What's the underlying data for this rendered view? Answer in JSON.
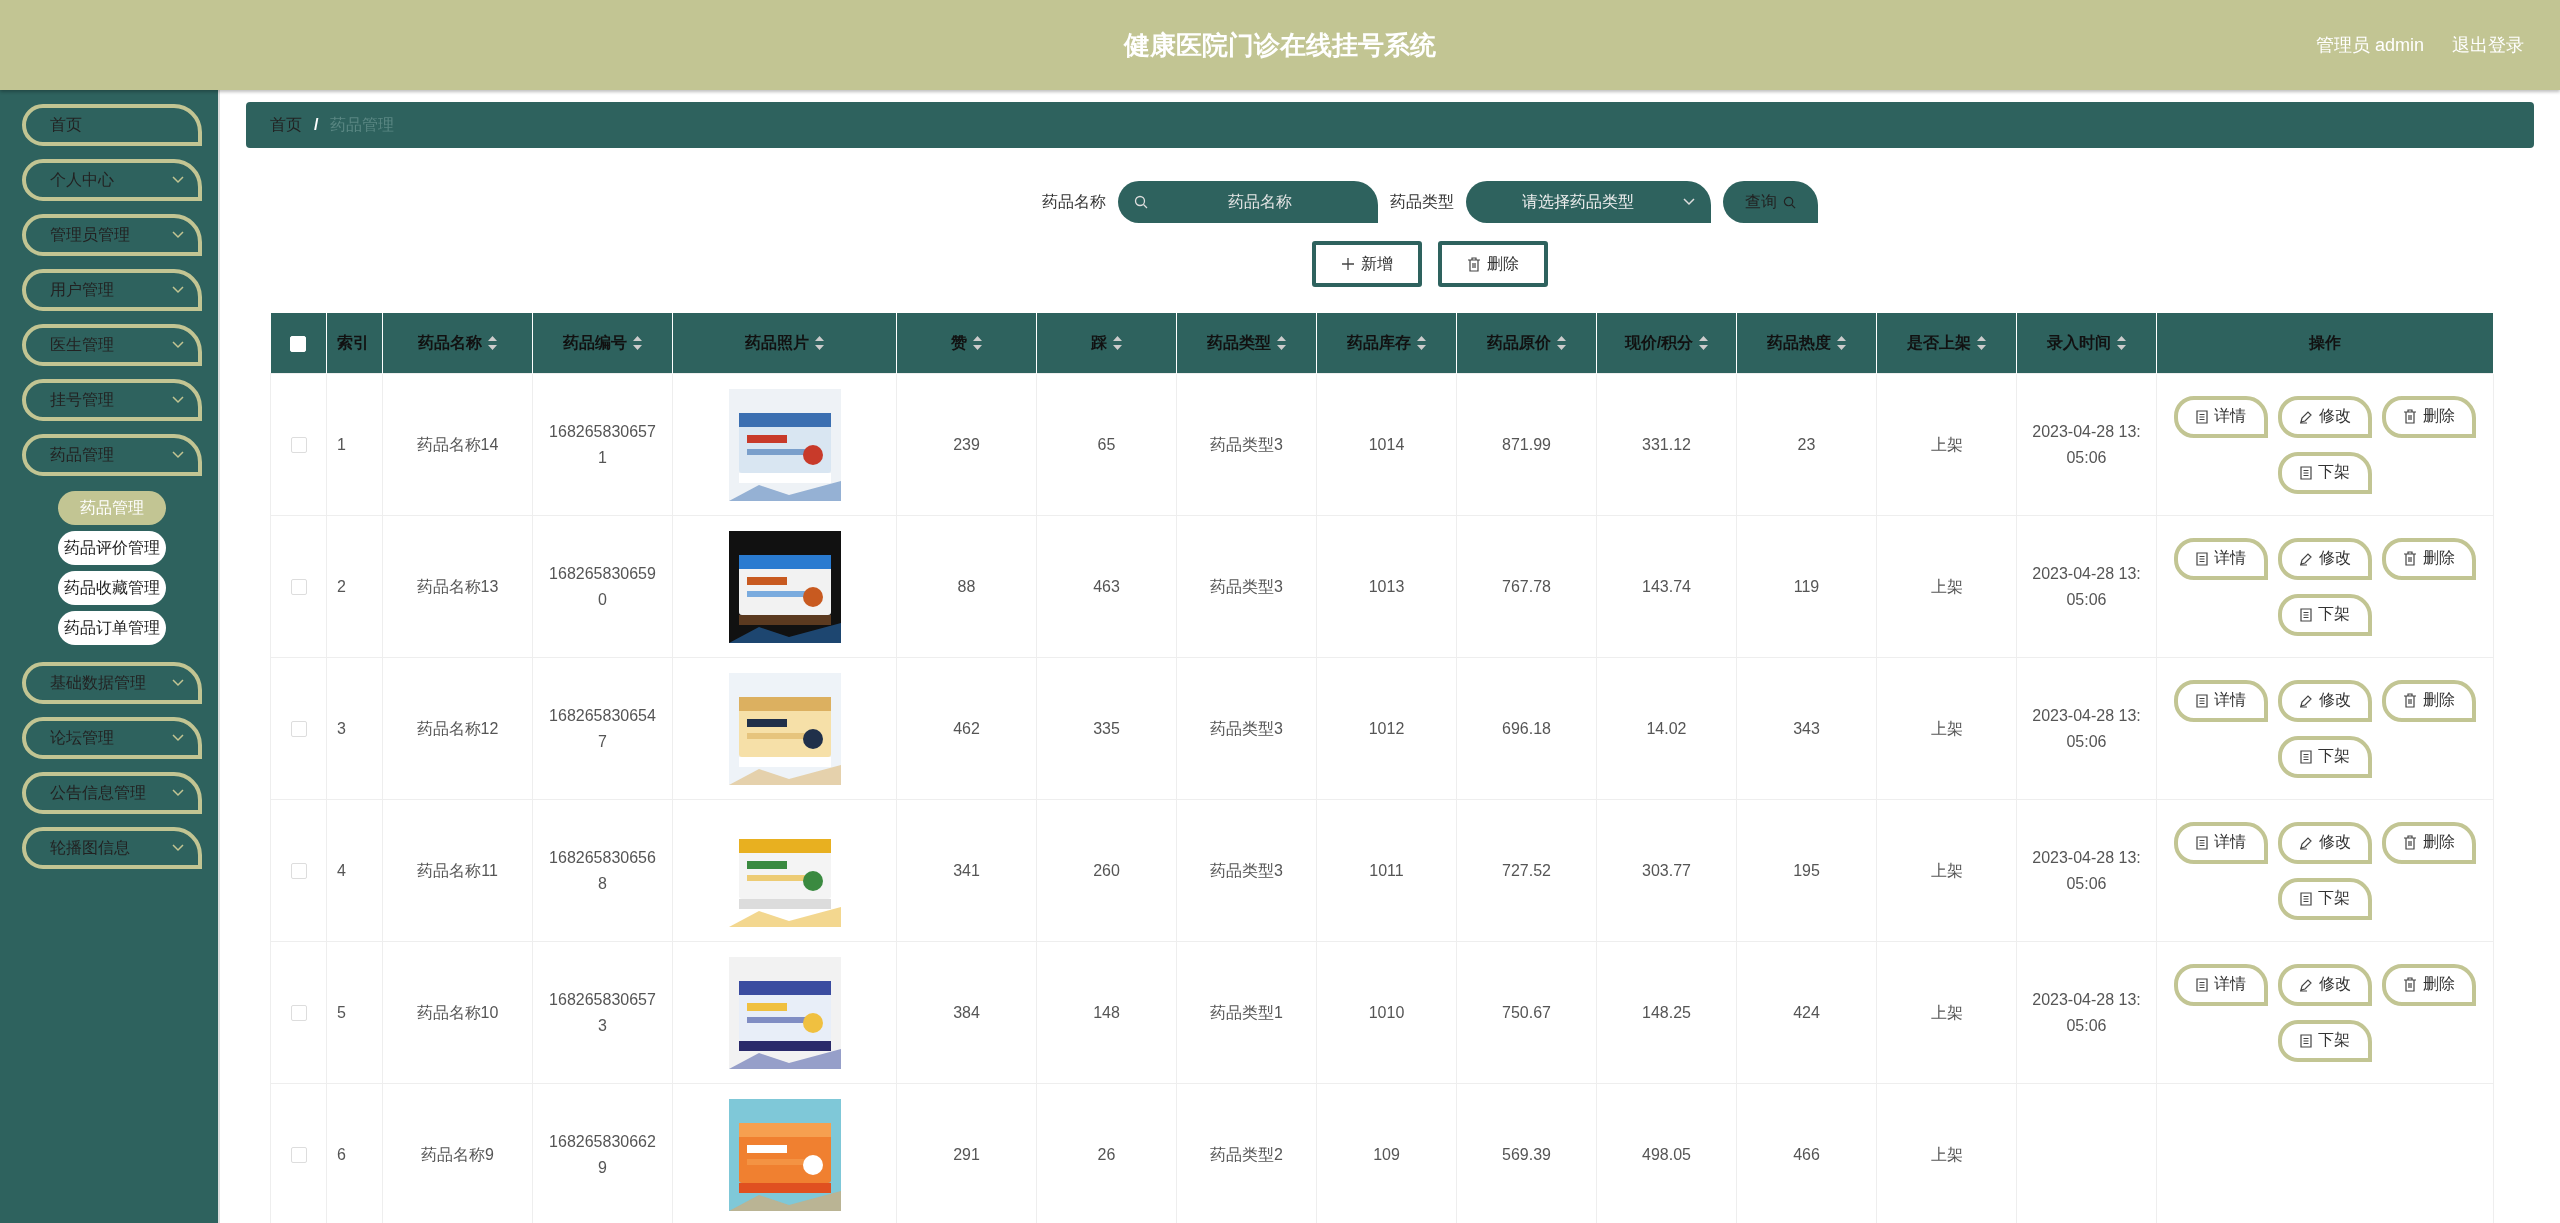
{
  "header": {
    "title": "健康医院门诊在线挂号系统",
    "user": "管理员 admin",
    "logout": "退出登录"
  },
  "sidebar": {
    "items": [
      {
        "label": "首页",
        "kind": "link"
      },
      {
        "label": "个人中心",
        "kind": "menu"
      },
      {
        "label": "管理员管理",
        "kind": "menu"
      },
      {
        "label": "用户管理",
        "kind": "menu"
      },
      {
        "label": "医生管理",
        "kind": "menu"
      },
      {
        "label": "挂号管理",
        "kind": "menu"
      },
      {
        "label": "药品管理",
        "kind": "menu",
        "children": [
          {
            "label": "药品管理",
            "selected": true
          },
          {
            "label": "药品评价管理",
            "selected": false
          },
          {
            "label": "药品收藏管理",
            "selected": false
          },
          {
            "label": "药品订单管理",
            "selected": false
          }
        ]
      },
      {
        "label": "基础数据管理",
        "kind": "menu"
      },
      {
        "label": "论坛管理",
        "kind": "menu"
      },
      {
        "label": "公告信息管理",
        "kind": "menu"
      },
      {
        "label": "轮播图信息",
        "kind": "menu"
      }
    ]
  },
  "breadcrumb": {
    "separator": "/",
    "items": [
      "首页",
      "药品管理"
    ]
  },
  "search": {
    "fields": [
      {
        "label": "药品名称",
        "kind": "text",
        "placeholder": "药品名称"
      },
      {
        "label": "药品类型",
        "kind": "select",
        "placeholder": "请选择药品类型"
      }
    ],
    "button": "查询"
  },
  "actions": [
    {
      "label": "新增",
      "kind": "add"
    },
    {
      "label": "删除",
      "kind": "delete"
    }
  ],
  "table": {
    "select_all": {
      "checked": false
    },
    "columns": [
      {
        "label": "索引",
        "sortable": false
      },
      {
        "label": "药品名称",
        "sortable": true
      },
      {
        "label": "药品编号",
        "sortable": true
      },
      {
        "label": "药品照片",
        "sortable": true
      },
      {
        "label": "赞",
        "sortable": true
      },
      {
        "label": "踩",
        "sortable": true
      },
      {
        "label": "药品类型",
        "sortable": true
      },
      {
        "label": "药品库存",
        "sortable": true
      },
      {
        "label": "药品原价",
        "sortable": true
      },
      {
        "label": "现价/积分",
        "sortable": true
      },
      {
        "label": "药品热度",
        "sortable": true
      },
      {
        "label": "是否上架",
        "sortable": true
      },
      {
        "label": "录入时间",
        "sortable": true
      },
      {
        "label": "操作",
        "sortable": false
      }
    ],
    "rows": [
      {
        "checked": false,
        "index": "1",
        "name": "药品名称14",
        "code": "1682658306571",
        "likes": "239",
        "dislikes": "65",
        "type": "药品类型3",
        "stock": "1014",
        "price": "871.99",
        "points": "331.12",
        "heat": "23",
        "listed": "上架",
        "time": "2023-04-28 13:05:06",
        "actions": [
          {
            "label": "详情",
            "kind": "detail"
          },
          {
            "label": "修改",
            "kind": "edit"
          },
          {
            "label": "删除",
            "kind": "delete"
          },
          {
            "label": "下架",
            "kind": "detail"
          }
        ]
      },
      {
        "checked": false,
        "index": "2",
        "name": "药品名称13",
        "code": "1682658306590",
        "likes": "88",
        "dislikes": "463",
        "type": "药品类型3",
        "stock": "1013",
        "price": "767.78",
        "points": "143.74",
        "heat": "119",
        "listed": "上架",
        "time": "2023-04-28 13:05:06",
        "actions": [
          {
            "label": "详情",
            "kind": "detail"
          },
          {
            "label": "修改",
            "kind": "edit"
          },
          {
            "label": "删除",
            "kind": "delete"
          },
          {
            "label": "下架",
            "kind": "detail"
          }
        ]
      },
      {
        "checked": false,
        "index": "3",
        "name": "药品名称12",
        "code": "1682658306547",
        "likes": "462",
        "dislikes": "335",
        "type": "药品类型3",
        "stock": "1012",
        "price": "696.18",
        "points": "14.02",
        "heat": "343",
        "listed": "上架",
        "time": "2023-04-28 13:05:06",
        "actions": [
          {
            "label": "详情",
            "kind": "detail"
          },
          {
            "label": "修改",
            "kind": "edit"
          },
          {
            "label": "删除",
            "kind": "delete"
          },
          {
            "label": "下架",
            "kind": "detail"
          }
        ]
      },
      {
        "checked": false,
        "index": "4",
        "name": "药品名称11",
        "code": "1682658306568",
        "likes": "341",
        "dislikes": "260",
        "type": "药品类型3",
        "stock": "1011",
        "price": "727.52",
        "points": "303.77",
        "heat": "195",
        "listed": "上架",
        "time": "2023-04-28 13:05:06",
        "actions": [
          {
            "label": "详情",
            "kind": "detail"
          },
          {
            "label": "修改",
            "kind": "edit"
          },
          {
            "label": "删除",
            "kind": "delete"
          },
          {
            "label": "下架",
            "kind": "detail"
          }
        ]
      },
      {
        "checked": false,
        "index": "5",
        "name": "药品名称10",
        "code": "1682658306573",
        "likes": "384",
        "dislikes": "148",
        "type": "药品类型1",
        "stock": "1010",
        "price": "750.67",
        "points": "148.25",
        "heat": "424",
        "listed": "上架",
        "time": "2023-04-28 13:05:06",
        "actions": [
          {
            "label": "详情",
            "kind": "detail"
          },
          {
            "label": "修改",
            "kind": "edit"
          },
          {
            "label": "删除",
            "kind": "delete"
          },
          {
            "label": "下架",
            "kind": "detail"
          }
        ]
      },
      {
        "checked": false,
        "index": "6",
        "name": "药品名称9",
        "code": "1682658306629",
        "likes": "291",
        "dislikes": "26",
        "type": "药品类型2",
        "stock": "109",
        "price": "569.39",
        "points": "498.05",
        "heat": "466",
        "listed": "上架"
      }
    ]
  }
}
